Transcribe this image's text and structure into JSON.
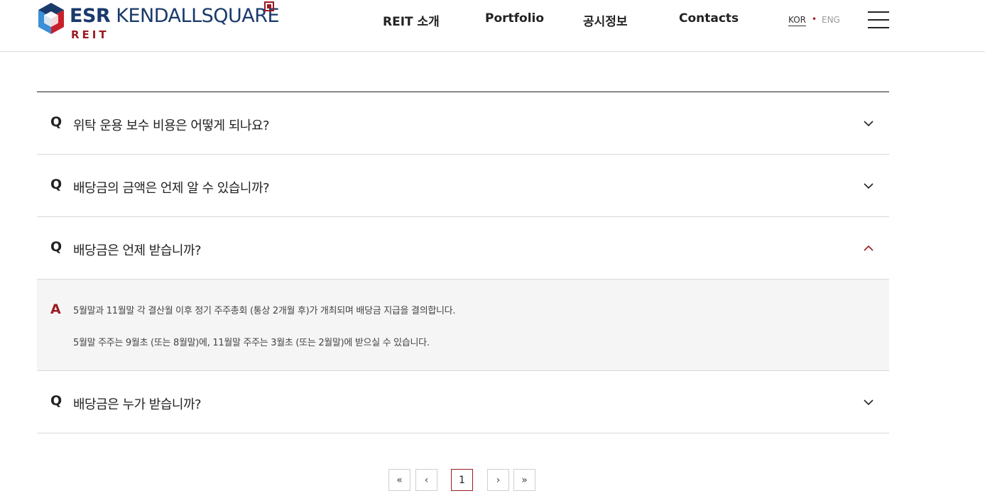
{
  "header": {
    "logo": {
      "brand": "ESR",
      "name": "KENDALLSQUARE",
      "sub": "REIT"
    },
    "nav": [
      {
        "label": "REIT 소개"
      },
      {
        "label": "Portfolio"
      },
      {
        "label": "공시정보"
      },
      {
        "label": "Contacts"
      }
    ],
    "lang": {
      "kor": "KOR",
      "separator": "•",
      "eng": "ENG",
      "active": "KOR"
    }
  },
  "faq": {
    "items": [
      {
        "q_mark": "Q",
        "question": "위탁 운용 보수 비용은 어떻게 되나요?",
        "expanded": false
      },
      {
        "q_mark": "Q",
        "question": "배당금의 금액은 언제 알 수 있습니까?",
        "expanded": false
      },
      {
        "q_mark": "Q",
        "question": "배당금은 언제 받습니까?",
        "expanded": true,
        "a_mark": "A",
        "answer_lines": [
          "5월말과 11월말 각 결산월 이후 정기 주주총회 (통상 2개월 후)가 개최되며 배당금 지급을 결의합니다.",
          "5월말 주주는 9월초 (또는 8월말)에, 11월말 주주는 3월초 (또는 2월말)에 받으실 수 있습니다."
        ]
      },
      {
        "q_mark": "Q",
        "question": "배당금은 누가 받습니까?",
        "expanded": false
      }
    ]
  },
  "pagination": {
    "first": "«",
    "prev": "‹",
    "current": "1",
    "next": "›",
    "last": "»"
  },
  "colors": {
    "accent": "#9b1b22",
    "brand_blue": "#1a3a6b",
    "answer_bg": "#f5f5f5"
  }
}
